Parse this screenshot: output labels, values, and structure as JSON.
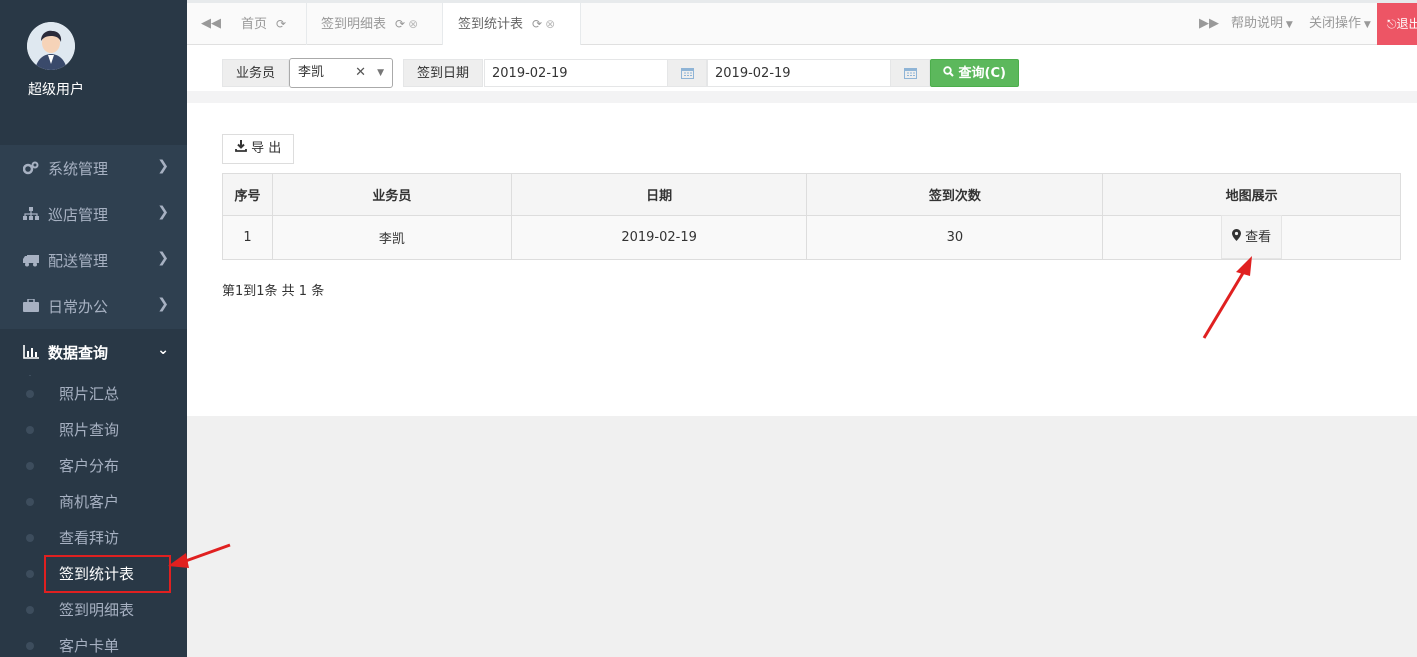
{
  "sidebar": {
    "user": {
      "name": "超级用户"
    },
    "menu": [
      {
        "label": "系统管理",
        "icon": "gears-icon"
      },
      {
        "label": "巡店管理",
        "icon": "sitemap-icon"
      },
      {
        "label": "配送管理",
        "icon": "truck-icon"
      },
      {
        "label": "日常办公",
        "icon": "briefcase-icon"
      },
      {
        "label": "数据查询",
        "icon": "bar-chart-icon"
      }
    ],
    "submenu": [
      "照片汇总",
      "照片查询",
      "客户分布",
      "商机客户",
      "查看拜访",
      "签到统计表",
      "签到明细表",
      "客户卡单"
    ]
  },
  "tabs": {
    "home": "首页",
    "items": [
      {
        "label": "签到明细表"
      },
      {
        "label": "签到统计表"
      }
    ],
    "help": "帮助说明",
    "close_ops": "关闭操作",
    "logout": "退出"
  },
  "search": {
    "salesman_label": "业务员",
    "salesman_value": "李凯",
    "date_label": "签到日期",
    "date_from": "2019-02-19",
    "date_to": "2019-02-19",
    "query_button": "查询(C)"
  },
  "toolbar": {
    "export_label": "导 出"
  },
  "table": {
    "headers": [
      "序号",
      "业务员",
      "日期",
      "签到次数",
      "地图展示"
    ],
    "rows": [
      {
        "index": "1",
        "salesman": "李凯",
        "date": "2019-02-19",
        "count": "30",
        "action": "查看"
      }
    ]
  },
  "pagination": {
    "info": "第1到1条 共 1 条"
  },
  "colors": {
    "sidebar_bg": "#2f4050",
    "query_green": "#5cb85c",
    "logout_red": "#ed5565",
    "annotation_red": "#e02020"
  }
}
